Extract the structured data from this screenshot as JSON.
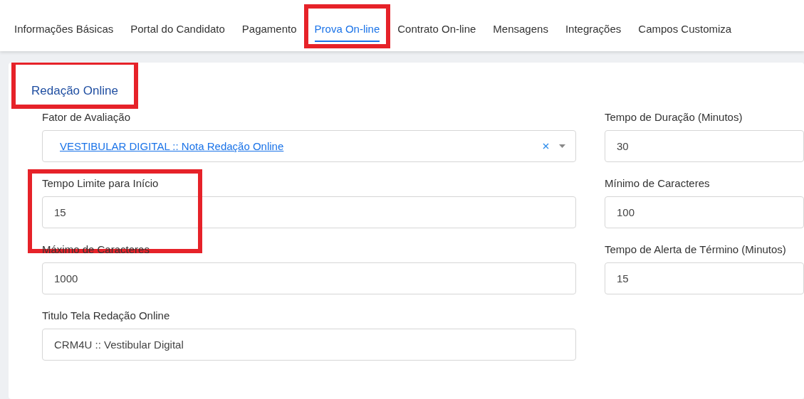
{
  "tabs": [
    {
      "label": "Informações Básicas",
      "selected": false,
      "highlighted": false
    },
    {
      "label": "Portal do Candidato",
      "selected": false,
      "highlighted": false
    },
    {
      "label": "Pagamento",
      "selected": false,
      "highlighted": false
    },
    {
      "label": "Prova On-line",
      "selected": true,
      "highlighted": true
    },
    {
      "label": "Contrato On-line",
      "selected": false,
      "highlighted": false
    },
    {
      "label": "Mensagens",
      "selected": false,
      "highlighted": false
    },
    {
      "label": "Integrações",
      "selected": false,
      "highlighted": false
    },
    {
      "label": "Campos Customiza",
      "selected": false,
      "highlighted": false
    }
  ],
  "section": {
    "title": "Redação Online",
    "highlighted": true
  },
  "fields": [
    {
      "kind": "select",
      "label": "Fator de Avaliação",
      "value": "VESTIBULAR DIGITAL :: Nota Redação Online",
      "highlighted": false
    },
    {
      "kind": "text",
      "label": "Tempo de Duração (Minutos)",
      "value": "30",
      "highlighted": false
    },
    {
      "kind": "text",
      "label": "Tempo Limite para Início",
      "value": "15",
      "highlighted": true
    },
    {
      "kind": "text",
      "label": "Mínimo de Caracteres",
      "value": "100",
      "highlighted": false
    },
    {
      "kind": "text",
      "label": "Máximo de Caracteres",
      "value": "1000",
      "highlighted": false
    },
    {
      "kind": "text",
      "label": "Tempo de Alerta de Término (Minutos)",
      "value": "15",
      "highlighted": false
    },
    {
      "kind": "text",
      "label": "Titulo Tela Redação Online",
      "value": "CRM4U :: Vestibular Digital",
      "highlighted": false
    }
  ]
}
